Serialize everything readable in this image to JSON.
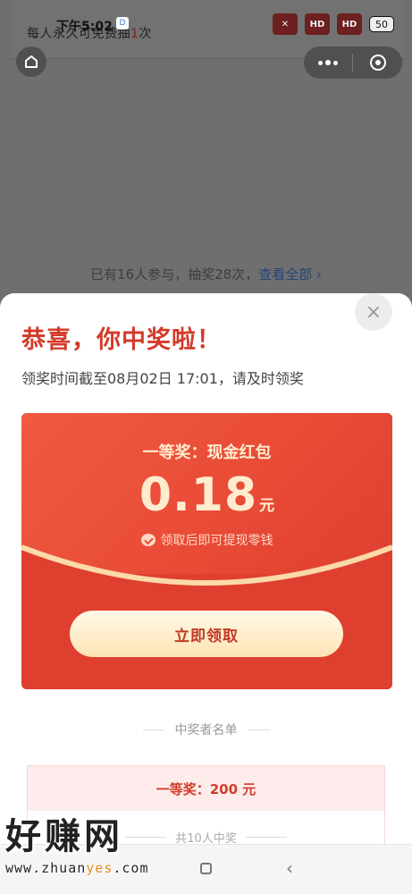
{
  "status_bar": {
    "time": "下午5:02",
    "app_icon": "D",
    "signal1": "HD",
    "signal2": "HD",
    "battery": "50"
  },
  "background": {
    "free_once_prefix": "每人永久可免费抽",
    "free_once_num": "1",
    "free_once_suffix": "次",
    "participants_text": "已有16人参与，抽奖28次，",
    "view_all": "查看全部"
  },
  "sheet": {
    "close_icon": "×",
    "congrats": "恭喜，你中奖啦！",
    "deadline": "领奖时间截至08月02日 17:01，请及时领奖",
    "card": {
      "prize_title": "一等奖：现金红包",
      "amount": "0.18",
      "unit": "元",
      "withdraw_note": "领取后即可提现零钱",
      "claim_button": "立即领取"
    },
    "winners": {
      "title": "中奖者名单",
      "tier_label": "一等奖：200 元",
      "count": "共10人中奖"
    }
  },
  "watermark": {
    "big": "好赚网",
    "url_prefix": "www.zhuan",
    "url_highlight": "yes",
    "url_suffix": ".com"
  },
  "nav_bar": {
    "back_icon": "‹"
  },
  "colors": {
    "accent_red": "#d33b2a",
    "card_red": "#df3f2f",
    "button_gold": "#fde4b6"
  }
}
